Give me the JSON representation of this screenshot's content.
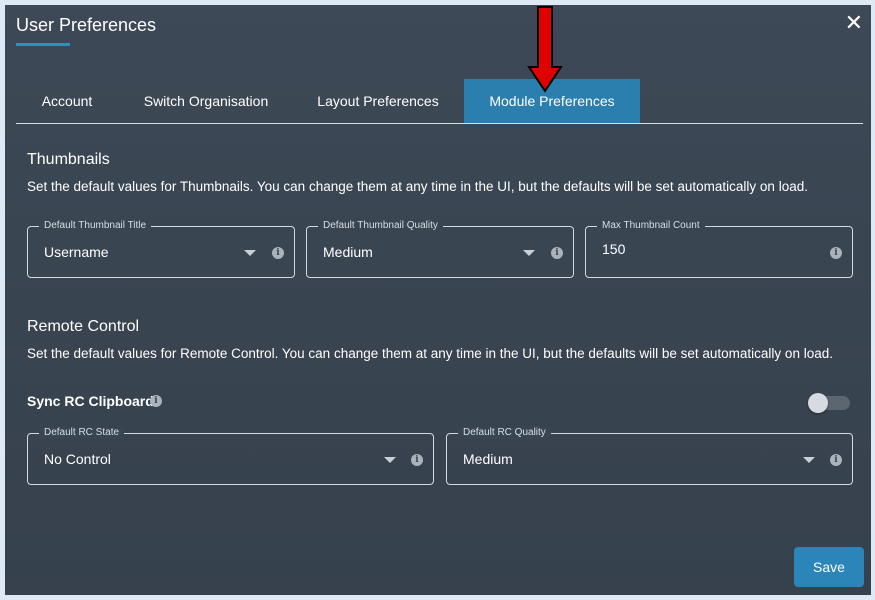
{
  "dialog": {
    "title": "User Preferences",
    "close_glyph": "✕"
  },
  "tabs": [
    {
      "label": "Account",
      "active": false
    },
    {
      "label": "Switch Organisation",
      "active": false
    },
    {
      "label": "Layout Preferences",
      "active": false
    },
    {
      "label": "Module Preferences",
      "active": true
    }
  ],
  "thumbnails": {
    "title": "Thumbnails",
    "description": "Set the default values for Thumbnails. You can change them at any time in the UI, but the defaults will be set automatically on load.",
    "fields": [
      {
        "label": "Default Thumbnail Title",
        "value": "Username"
      },
      {
        "label": "Default Thumbnail Quality",
        "value": "Medium"
      },
      {
        "label": "Max Thumbnail Count",
        "value": "150"
      }
    ]
  },
  "remote_control": {
    "title": "Remote Control",
    "description": "Set the default values for Remote Control. You can change them at any time in the UI, but the defaults will be set automatically on load.",
    "sync_label": "Sync RC Clipboard",
    "sync_enabled": false,
    "fields": [
      {
        "label": "Default RC State",
        "value": "No Control"
      },
      {
        "label": "Default RC Quality",
        "value": "Medium"
      }
    ]
  },
  "footer": {
    "save_label": "Save"
  },
  "icons": {
    "info": "i"
  },
  "colors": {
    "accent": "#2a7fae",
    "annotation_arrow": "#e00000"
  }
}
